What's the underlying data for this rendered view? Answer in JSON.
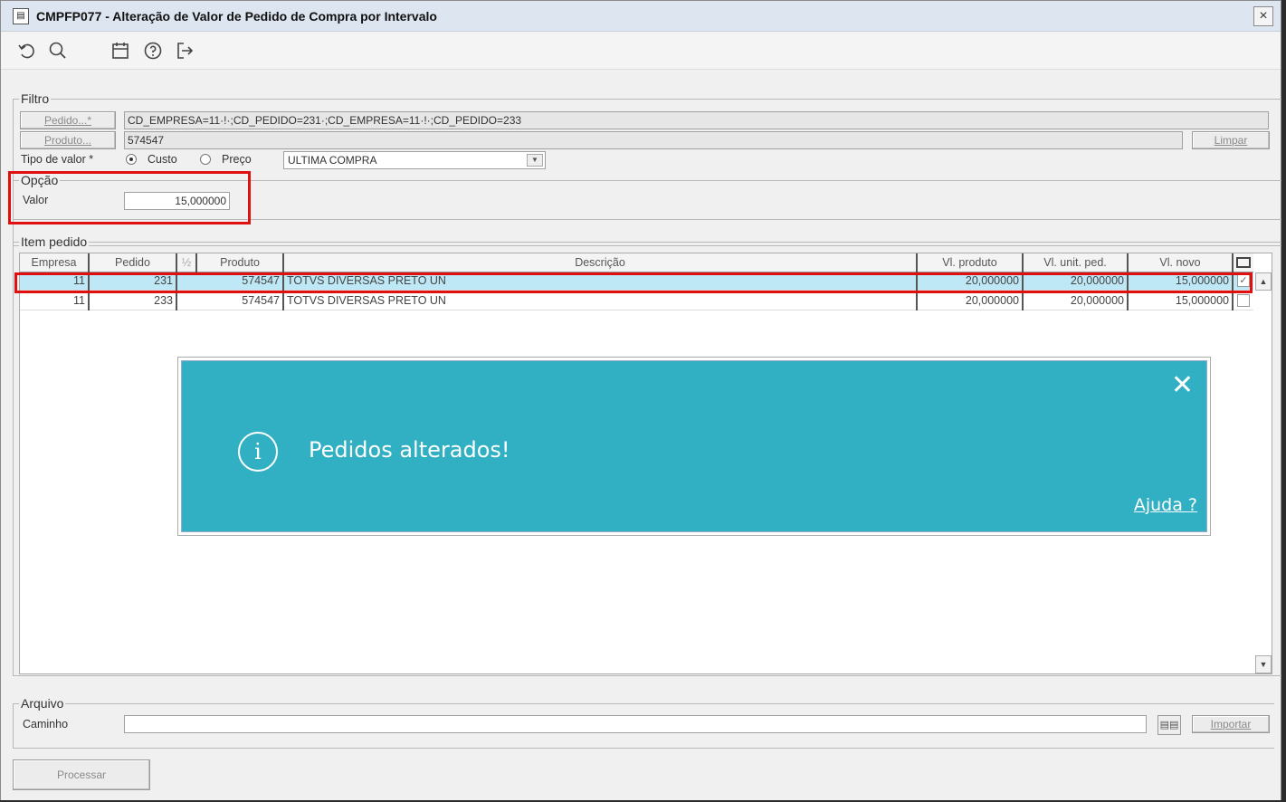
{
  "window": {
    "title": "CMPFP077 - Alteração de Valor de Pedido de Compra por Intervalo",
    "close_glyph": "×"
  },
  "toolbar": {
    "icons": [
      "undo-icon",
      "search-icon",
      "calendar-icon",
      "help-icon",
      "exit-icon"
    ]
  },
  "filtro": {
    "legend": "Filtro",
    "pedido_button": "Pedido...*",
    "pedido_value": "CD_EMPRESA=11·!·;CD_PEDIDO=231·;CD_EMPRESA=11·!·;CD_PEDIDO=233",
    "produto_button": "Produto...",
    "produto_value": "574547",
    "limpar_button": "Limpar",
    "tipo_valor_label": "Tipo de valor *",
    "radio_custo": "Custo",
    "radio_preco": "Preço",
    "selected_radio": "Custo",
    "select_value": "ULTIMA COMPRA"
  },
  "opcao": {
    "legend": "Opção",
    "valor_label": "Valor",
    "valor_value": "15,000000"
  },
  "item_pedido": {
    "legend": "Item pedido",
    "columns": [
      "Empresa",
      "Pedido",
      "½",
      "Produto",
      "Descrição",
      "Vl. produto",
      "Vl. unit. ped.",
      "Vl. novo",
      ""
    ],
    "rows": [
      {
        "empresa": "11",
        "pedido": "231",
        "produto": "574547",
        "descricao": "TOTVS DIVERSAS PRETO UN",
        "vl_produto": "20,000000",
        "vl_unit_ped": "20,000000",
        "vl_novo": "15,000000",
        "checked": "✓"
      },
      {
        "empresa": "11",
        "pedido": "233",
        "produto": "574547",
        "descricao": "TOTVS DIVERSAS PRETO UN",
        "vl_produto": "20,000000",
        "vl_unit_ped": "20,000000",
        "vl_novo": "15,000000",
        "checked": ""
      }
    ]
  },
  "toast": {
    "message": "Pedidos alterados!",
    "help_link": "Ajuda ?",
    "close_glyph": "✕",
    "info_glyph": "i",
    "color": "#30b0c2"
  },
  "arquivo": {
    "legend": "Arquivo",
    "caminho_label": "Caminho",
    "caminho_value": "",
    "importar_button": "Importar"
  },
  "processar_button": "Processar",
  "accent_red": "#e01010"
}
